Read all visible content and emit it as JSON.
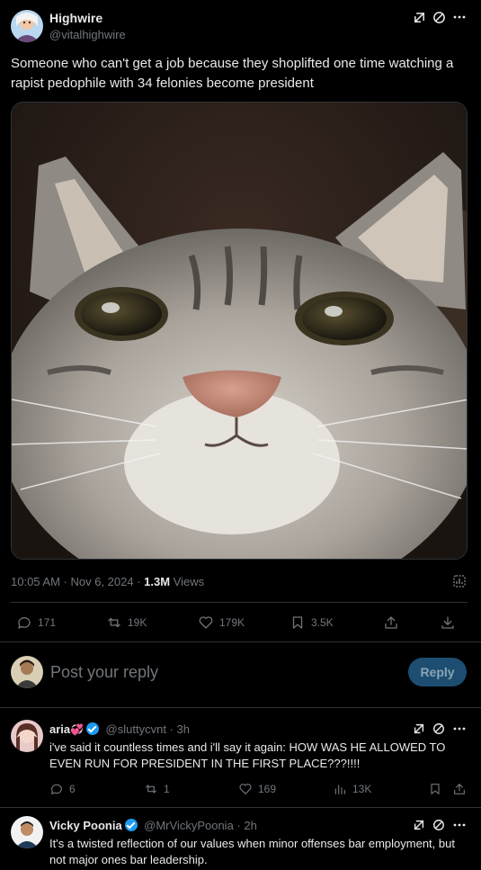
{
  "post": {
    "author_name": "Highwire",
    "author_handle": "@vitalhighwire",
    "text": "Someone who can't get a job because they shoplifted one time watching a rapist pedophile with 34 felonies become president",
    "timestamp": "10:05 AM · Nov 6, 2024 · ",
    "views_count": "1.3M",
    "views_label": "Views",
    "metrics": {
      "replies": "171",
      "reposts": "19K",
      "likes": "179K",
      "bookmarks": "3.5K"
    }
  },
  "composer": {
    "placeholder": "Post your reply",
    "reply_button": "Reply"
  },
  "replies": [
    {
      "name": "aria",
      "emoji": "💞",
      "handle": "@sluttycvnt · 3h",
      "text": "i've said it countless times and i'll say it again: HOW WAS HE ALLOWED TO EVEN RUN FOR PRESIDENT IN THE FIRST PLACE???!!!!",
      "metrics": {
        "replies": "6",
        "reposts": "1",
        "likes": "169",
        "views": "13K"
      }
    },
    {
      "name": "Vicky Poonia",
      "handle": "@MrVickyPoonia · 2h",
      "text": "It's a twisted reflection of our values when minor offenses bar employment, but not major ones bar leadership."
    }
  ],
  "colors": {
    "background": "#000000",
    "text": "#e7e9ea",
    "muted": "#71767b",
    "accent": "#1d9bf0",
    "divider": "#2f3336"
  }
}
